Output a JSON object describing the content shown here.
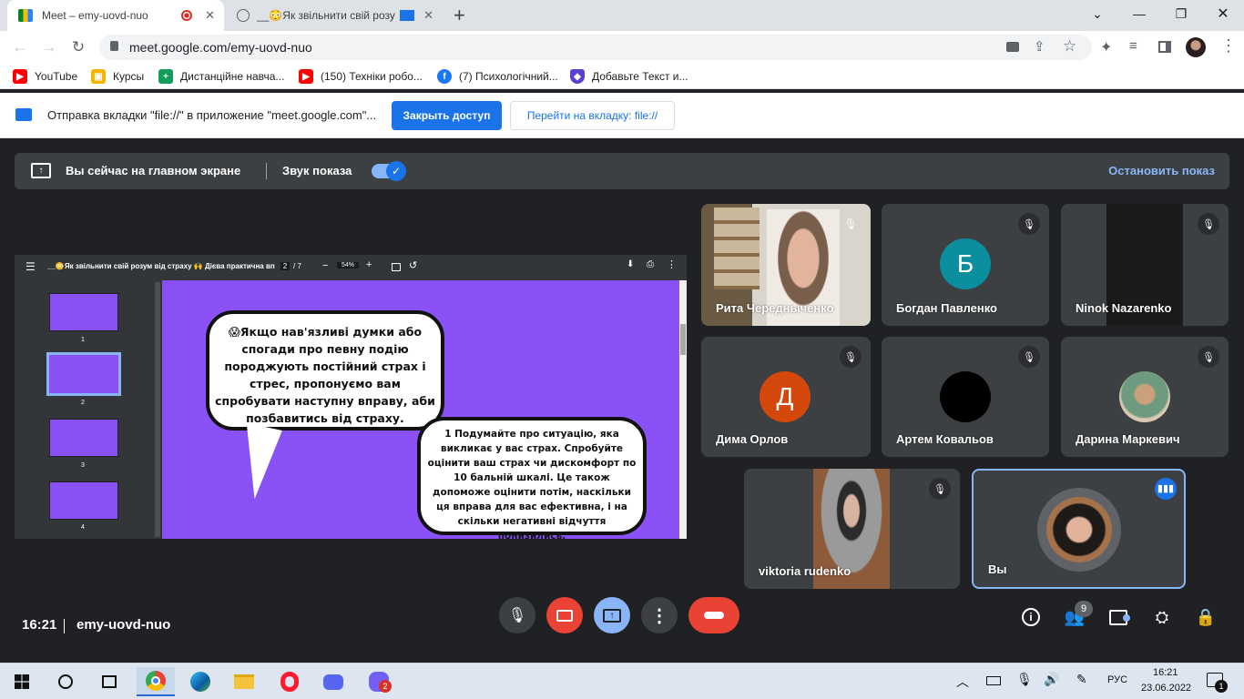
{
  "browser": {
    "tabs": [
      {
        "title": "Meet – emy-uovd-nuo"
      },
      {
        "title": "__😳Як звільнити свій розу"
      }
    ],
    "new_tab": "+",
    "url": "meet.google.com/emy-uovd-nuo",
    "bookmarks": [
      {
        "label": "YouTube",
        "color": "#ff0000"
      },
      {
        "label": "Курсы",
        "color": "#f4b400"
      },
      {
        "label": "Дистанційне навча...",
        "color": "#0f9d58"
      },
      {
        "label": "(150) Техніки робо...",
        "color": "#ff0000"
      },
      {
        "label": "(7) Психологічний...",
        "color": "#1877f2"
      },
      {
        "label": "Добавьте Текст и...",
        "color": "#5b3fd1"
      }
    ],
    "infobar": {
      "text": "Отправка вкладки \"file://\" в приложение \"meet.google.com\"...",
      "primary": "Закрыть доступ",
      "secondary": "Перейти на вкладку: file://"
    }
  },
  "meet": {
    "presenting_text": "Вы сейчас на главном экране",
    "sound_label": "Звук показа",
    "stop_label": "Остановить показ",
    "time": "16:21",
    "meeting_code": "emy-uovd-nuo",
    "people_count": "9",
    "participants": [
      {
        "name": "Рита Чередныченко",
        "type": "video"
      },
      {
        "name": "Богдан Павленко",
        "type": "letter",
        "letter": "Б",
        "color": "#0b8e9e"
      },
      {
        "name": "Ninok Nazarenko",
        "type": "dark"
      },
      {
        "name": "Дима Орлов",
        "type": "letter",
        "letter": "Д",
        "color": "#d5480c"
      },
      {
        "name": "Артем Ковальов",
        "type": "black"
      },
      {
        "name": "Дарина Маркевич",
        "type": "photo"
      },
      {
        "name": "viktoria rudenko",
        "type": "video"
      },
      {
        "name": "Вы",
        "type": "self"
      }
    ]
  },
  "pdf": {
    "title": "__😳Як звільнити свій розум від страху 🙌 Дієва практична вправ...",
    "page_current": "2",
    "page_total": "/ 7",
    "zoom": "54%",
    "thumbs": [
      "1",
      "2",
      "3",
      "4"
    ],
    "bubble1": "😱Якщо нав'язливі думки або спогади про певну подію породжують постійний страх і стрес, пропонуємо вам спробувати наступну вправу, аби позбавитись від страху.",
    "bubble2": "1  Подумайте про ситуацію, яка викликає у вас страх. Спробуйте оцінити ваш страх чи дискомфорт по 10 бальній шкалі. Це також допоможе оцінити потім, наскільки ця вправа для вас ефективна, і на скільки негативні відчуття понизились.",
    "bg": "#8a52f6"
  },
  "taskbar": {
    "lang": "РУС",
    "time": "16:21",
    "date": "23.06.2022",
    "notif": "1",
    "viber_badge": "2"
  }
}
